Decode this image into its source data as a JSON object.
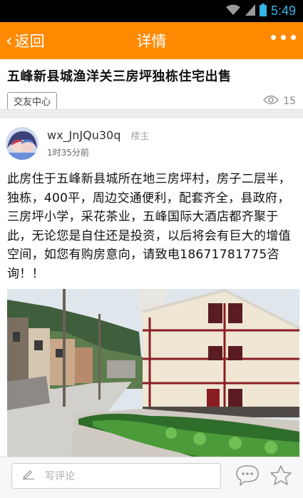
{
  "status_bar": {
    "time": "5:49"
  },
  "nav": {
    "back_label": "返回",
    "title": "详情"
  },
  "post": {
    "title": "五峰新县城渔洋关三房坪独栋住宅出售",
    "forum_tag": "交友中心",
    "view_count": "15"
  },
  "author": {
    "name": "wx_JnJQu30q",
    "badge": "楼主",
    "time": "1时35分前"
  },
  "content": {
    "body": "此房住于五峰新县城所在地三房坪村，房子二层半，独栋，400平，周边交通便利，配套齐全，县政府，三房坪小学，采花茶业，五峰国际大酒店都齐聚于此，无论您是自住还是投资，以后将会有巨大的增值空间，如您有购房意向，请致电18671781775咨询！！"
  },
  "bottom_bar": {
    "comment_placeholder": "写评论"
  },
  "icons": {
    "back": "chevron-left-icon",
    "more": "more-dots-icon",
    "views": "eye-icon",
    "compose": "pencil-icon",
    "comment": "chat-bubble-icon",
    "favorite": "star-icon",
    "wifi": "wifi-icon",
    "signal": "signal-icon",
    "battery": "battery-icon"
  },
  "colors": {
    "nav_background": "#ff8a00",
    "status_time": "#33b5e5"
  }
}
